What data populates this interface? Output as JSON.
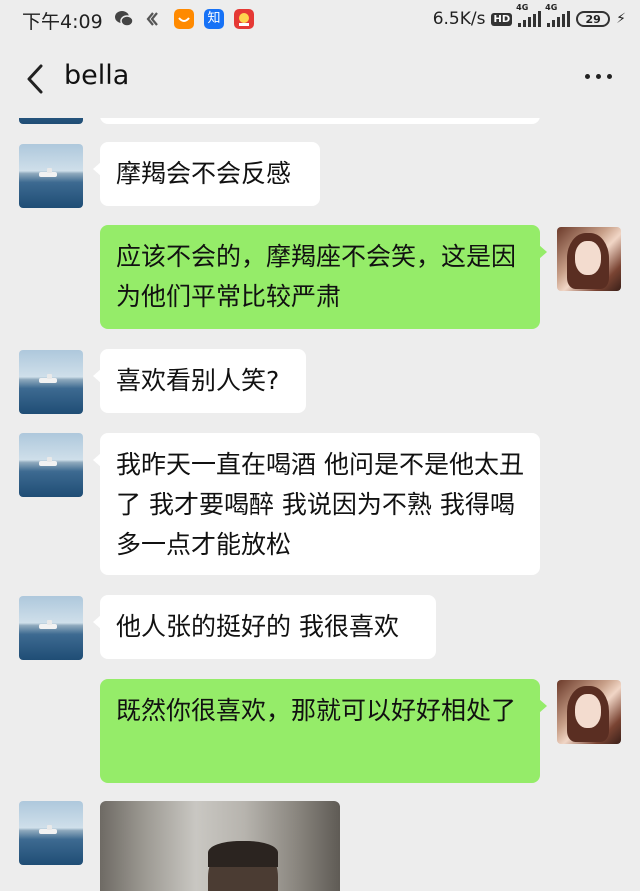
{
  "status_bar": {
    "time": "下午4:09",
    "network_speed": "6.5K/s",
    "hd_label": "HD",
    "signal1_label": "4G",
    "signal2_label": "4G",
    "battery_level": "29",
    "app_icons": [
      "wechat-icon",
      "feed-icon",
      "taobao-icon",
      "zhihu-icon",
      "news-app-icon"
    ],
    "colors": {
      "taobao": "#ff8a00",
      "zhihu": "#1772f6",
      "news": "#e53935"
    }
  },
  "nav": {
    "title": "bella",
    "back_icon": "chevron-left-icon",
    "more_icon": "more-dots-icon"
  },
  "colors": {
    "background": "#ededed",
    "sent_bubble": "#95ec69",
    "received_bubble": "#ffffff"
  },
  "messages": [
    {
      "side": "left",
      "text": "摩羯会不会反感"
    },
    {
      "side": "right",
      "text": "应该不会的，摩羯座不会笑，这是因为他们平常比较严肃"
    },
    {
      "side": "left",
      "text": "喜欢看别人笑?"
    },
    {
      "side": "left",
      "text": "我昨天一直在喝酒 他问是不是他太丑了 我才要喝醉 我说因为不熟 我得喝多一点才能放松"
    },
    {
      "side": "left",
      "text": "他人张的挺好的 我很喜欢"
    },
    {
      "side": "right",
      "text": "既然你很喜欢，那就可以好好相处了"
    },
    {
      "side": "left",
      "text": "",
      "type": "image",
      "image_desc": "photo-message"
    }
  ]
}
